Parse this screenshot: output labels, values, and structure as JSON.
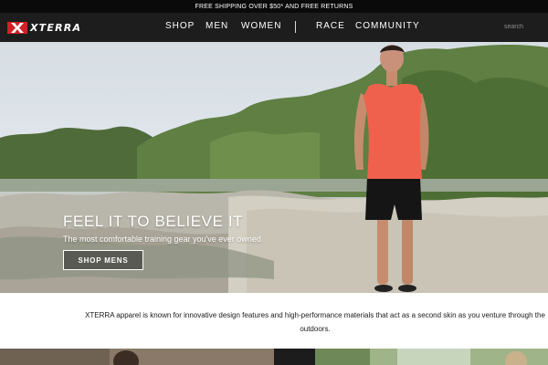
{
  "promo": {
    "text": "FREE SHIPPING OVER $50* AND FREE RETURNS"
  },
  "header": {
    "logo_text": "XTERRA",
    "nav": [
      {
        "label": "SHOP"
      },
      {
        "label": "MEN"
      },
      {
        "label": "WOMEN"
      },
      {
        "label": "RACE"
      },
      {
        "label": "COMMUNITY"
      }
    ],
    "search": {
      "placeholder": "search",
      "value": ""
    }
  },
  "hero": {
    "title": "FEEL IT TO BELIEVE IT",
    "subtitle": "The most comfortable training gear you've ever owned",
    "cta_label": "SHOP MENS"
  },
  "intro": {
    "text": "XTERRA apparel is known for innovative design features and high-performance materials that act as a second skin as you venture through the outdoors."
  },
  "colors": {
    "brand_red": "#d32027",
    "nav_bg": "#1d1d1d",
    "promo_bg": "#0a0a0a",
    "shirt": "#f0614d"
  },
  "icons": {
    "logo": "xterra-x-mark"
  }
}
